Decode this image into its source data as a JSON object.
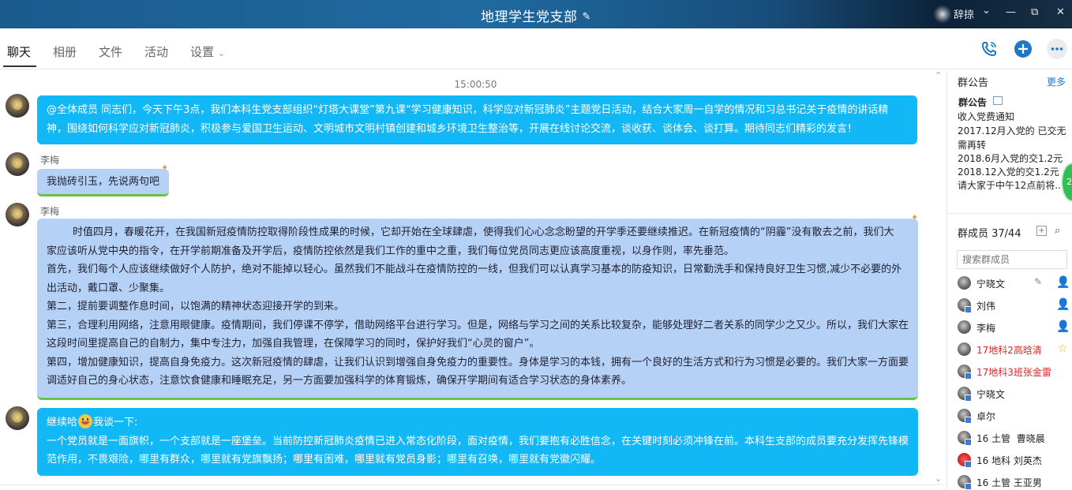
{
  "window": {
    "title": "地理学生党支部",
    "user_label": "辞掠",
    "controls": {
      "chevron": "⌄",
      "minimize": "—",
      "restore": "⧉",
      "close": "✕"
    }
  },
  "tabs": [
    {
      "label": "聊天",
      "active": true
    },
    {
      "label": "相册"
    },
    {
      "label": "文件"
    },
    {
      "label": "活动"
    },
    {
      "label": "设置"
    }
  ],
  "toolbar": {
    "call_icon": "phone-icon",
    "add_icon": "plus-circle-icon",
    "more_icon": "more-icon"
  },
  "chat": {
    "timestamp": "15:00:50",
    "messages": [
      {
        "sender": "",
        "lines": [
          "@全体成员 同志们，今天下午3点，我们本科生党支部组织“灯塔大课堂”第九课“学习健康知识，科学应对新冠肺炎”主题党日活动，结合大家周一自学的情况和习总书记关于疫情的讲话精",
          "神，围绕如何科学应对新冠肺炎，积极参与爱国卫生运动、文明城市文明村镇创建和城乡环境卫生整治等，开展在线讨论交流，谈收获、谈体会、谈打算。期待同志们精彩的发言！"
        ]
      },
      {
        "sender": "李梅",
        "lines": [
          "我抛砖引玉，先说两句吧"
        ]
      },
      {
        "sender": "李梅",
        "lines": [
          "        时值四月，春暖花开，在我国新冠疫情防控取得阶段性成果的时候，它却开始在全球肆虐，使得我们心心念念盼望的开学季还要继续推迟。在新冠疫情的“阴霾”没有散去之前，我们大",
          "家应该听从党中央的指令，在开学前期准备及开学后，疫情防控依然是我们工作的重中之重，我们每位党员同志更应该高度重视，以身作则，率先垂范。",
          "首先，我们每个人应该继续做好个人防护，绝对不能掉以轻心。虽然我们不能战斗在疫情防控的一线，但我们可以认真学习基本的防疫知识，日常勤洗手和保持良好卫生习惯,减少不必要的外",
          "出活动，戴口罩、少聚集。",
          "第二，提前要调整作息时间，以饱满的精神状态迎接开学的到来。",
          "第三，合理利用网络，注意用眼健康。疫情期间，我们停课不停学，借助网络平台进行学习。但是，网络与学习之间的关系比较复杂，能够处理好二者关系的同学少之又少。所以，我们大家在",
          "这段时间里提高自己的自制力，集中专注力，加强自我管理，在保障学习的同时，保护好我们“心灵的窗户”。",
          "第四，增加健康知识，提高自身免疫力。这次新冠疫情的肆虐，让我们认识到增强自身免疫力的重要性。身体是学习的本钱，拥有一个良好的生活方式和行为习惯是必要的。我们大家一方面要",
          "调适好自己的身心状态，注意饮食健康和睡眠充足，另一方面要加强科学的体育锻炼，确保开学期间有适合学习状态的身体素养。"
        ]
      },
      {
        "sender": "",
        "pre_emoji": "继续哈",
        "post_emoji": "我谈一下:",
        "lines": [
          "一个党员就是一面旗帜，一个支部就是一座堡垒。当前防控新冠肺炎疫情已进入常态化阶段，面对疫情，我们要抱有必胜信念，在关键时刻必须冲锋在前。本科生支部的成员要充分发挥先锋模",
          "范作用，不畏艰险，哪里有群众，哪里就有党旗飘扬；哪里有困难，哪里就有党员身影；哪里有召唤，哪里就有党徽闪耀。"
        ]
      }
    ]
  },
  "sidebar": {
    "announcement": {
      "header": "群公告",
      "more_label": "更多",
      "title": "群公告",
      "lines": [
        "收入党费通知",
        "2017.12月入党的 已交无",
        "需再转",
        "2018.6月入党的交1.2元",
        "2018.12入党的交1.2元",
        "请大家于中午12点前将..."
      ]
    },
    "members": {
      "header": "群成员 37/44",
      "search_placeholder": "搜索群成员",
      "list": [
        {
          "name": "宁晓文",
          "red": false,
          "role_icon": "👤",
          "role_color": "#e3a21a",
          "editable": true
        },
        {
          "name": "刘伟",
          "red": false,
          "role_icon": "👤",
          "role_color": "#3aa856"
        },
        {
          "name": "李梅",
          "red": false,
          "role_icon": "👤",
          "role_color": "#3aa856"
        },
        {
          "name": "17地科2高晗清",
          "red": true,
          "role_icon": "☆",
          "role_color": "#f2b313"
        },
        {
          "name": "17地科3班张金雷",
          "red": true
        },
        {
          "name": "宁晓文",
          "red": false
        },
        {
          "name": "卓尔",
          "red": false
        },
        {
          "name": "16 土管  曹晓晨",
          "red": false
        },
        {
          "name": "16 地科 刘英杰",
          "red": false
        },
        {
          "name": "16 土管 王亚男",
          "red": false
        }
      ]
    },
    "floating_badge": "2"
  }
}
